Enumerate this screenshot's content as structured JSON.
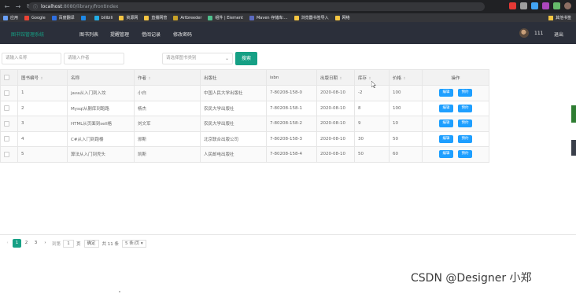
{
  "browser": {
    "url_host": "localhost",
    "url_rest": ":8080/library/frontIndex",
    "bookmarks": [
      {
        "label": "应用",
        "color": "#6aa0f7"
      },
      {
        "label": "Google",
        "color": "#ea4335"
      },
      {
        "label": "百度翻译",
        "color": "#2f6fe0"
      },
      {
        "label": "",
        "color": "#1e88e5"
      },
      {
        "label": "bilibili",
        "color": "#23ade5"
      },
      {
        "label": "资源网",
        "color": "#f4c542"
      },
      {
        "label": "直播网管",
        "color": "#f4c542"
      },
      {
        "label": "Artbreeder",
        "color": "#c9a227"
      },
      {
        "label": "组件 | Element",
        "color": "#4fc08d"
      },
      {
        "label": "Maven 存储库:...",
        "color": "#5c6bc0"
      },
      {
        "label": "浏览器书签导入",
        "color": "#f4c542"
      },
      {
        "label": "网络",
        "color": "#f4c542"
      }
    ],
    "bookmarks_right": "其他书签"
  },
  "app": {
    "brand": "图书馆管理系统",
    "nav": [
      "图书列表",
      "提醒管理",
      "借阅记录",
      "修改密码"
    ],
    "user": "111",
    "logout": "退出"
  },
  "filters": {
    "name_placeholder": "请输入名称",
    "author_placeholder": "请输入作者",
    "type_placeholder": "请选择图书类别",
    "search_label": "搜索"
  },
  "table": {
    "headers": [
      "图书编号",
      "名称",
      "作者",
      "出版社",
      "isbn",
      "出版日期",
      "库存",
      "价格",
      "操作"
    ],
    "rows": [
      [
        "1",
        "java从入门到入坟",
        "小白",
        "中国人民大学出版社",
        "7-80208-158-0",
        "2020-08-10",
        "-2",
        "100"
      ],
      [
        "2",
        "Mysql从删库到跑路",
        "杨杰",
        "农民大学出版社",
        "7-80208-158-1",
        "2020-08-10",
        "8",
        "100"
      ],
      [
        "3",
        "HTML从页面到sell格",
        "刘文军",
        "农民大学出版社",
        "7-80208-158-2",
        "2020-08-10",
        "9",
        "10"
      ],
      [
        "4",
        "C#从入门到跑楼",
        "邪斯",
        "北京联合出版公司",
        "7-80208-158-3",
        "2020-08-10",
        "30",
        "50"
      ],
      [
        "5",
        "算法从入门到秃头",
        "凯斯",
        "人民邮电出版社",
        "7-80208-158-4",
        "2020-08-10",
        "50",
        "60"
      ]
    ],
    "edit_label": "编辑",
    "borrow_label": "预约"
  },
  "pagination": {
    "pages": [
      "1",
      "2",
      "3"
    ],
    "current": "1",
    "goto_label": "到第",
    "goto_value": "1",
    "page_unit": "页",
    "confirm": "确定",
    "total": "共 11 条",
    "page_size": "5 条/页"
  },
  "watermark": "CSDN @Designer 小郑"
}
